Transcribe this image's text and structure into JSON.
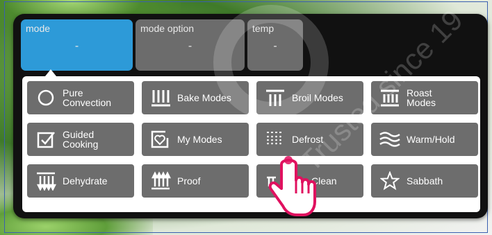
{
  "tabs": {
    "mode": {
      "label": "mode",
      "value": "-"
    },
    "mode_option": {
      "label": "mode option",
      "value": "-"
    },
    "temp": {
      "label": "temp",
      "value": "-"
    }
  },
  "modes": [
    {
      "label": "Pure\nConvection",
      "icon": "circle-icon"
    },
    {
      "label": "Bake Modes",
      "icon": "bake-icon"
    },
    {
      "label": "Broil Modes",
      "icon": "broil-icon"
    },
    {
      "label": "Roast\nModes",
      "icon": "roast-icon"
    },
    {
      "label": "Guided\nCooking",
      "icon": "checkbox-icon"
    },
    {
      "label": "My Modes",
      "icon": "heart-box-icon"
    },
    {
      "label": "Defrost",
      "icon": "defrost-icon"
    },
    {
      "label": "Warm/Hold",
      "icon": "waves-icon"
    },
    {
      "label": "Dehydrate",
      "icon": "dehydrate-icon"
    },
    {
      "label": "Proof",
      "icon": "proof-icon"
    },
    {
      "label": "Clean",
      "icon": "clean-icon"
    },
    {
      "label": "Sabbath",
      "icon": "star-icon"
    }
  ],
  "watermark": "Trusted since 19",
  "colors": {
    "accent": "#2d9ad8",
    "button": "#6d6d6d",
    "panel": "#111111",
    "hand": "#e0115f"
  }
}
